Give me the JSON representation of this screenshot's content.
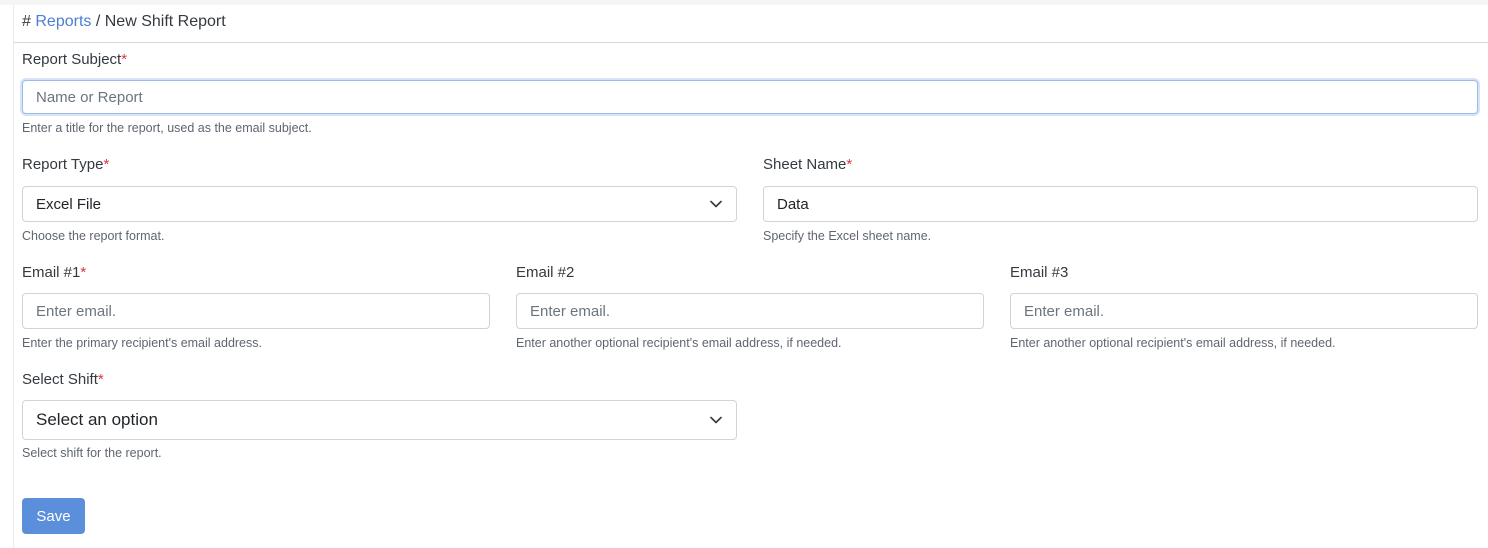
{
  "breadcrumb": {
    "hash": "#",
    "parent": "Reports",
    "separator": "/",
    "current": "New Shift Report"
  },
  "form": {
    "subject": {
      "label": "Report Subject",
      "required_mark": "*",
      "placeholder": "Name or Report",
      "value": "",
      "help": "Enter a title for the report, used as the email subject."
    },
    "report_type": {
      "label": "Report Type",
      "required_mark": "*",
      "selected": "Excel File",
      "help": "Choose the report format."
    },
    "sheet_name": {
      "label": "Sheet Name",
      "required_mark": "*",
      "value": "Data",
      "help": "Specify the Excel sheet name."
    },
    "email1": {
      "label": "Email #1",
      "required_mark": "*",
      "placeholder": "Enter email.",
      "value": "",
      "help": "Enter the primary recipient's email address."
    },
    "email2": {
      "label": "Email #2",
      "placeholder": "Enter email.",
      "value": "",
      "help": "Enter another optional recipient's email address, if needed."
    },
    "email3": {
      "label": "Email #3",
      "placeholder": "Enter email.",
      "value": "",
      "help": "Enter another optional recipient's email address, if needed."
    },
    "shift": {
      "label": "Select Shift",
      "required_mark": "*",
      "selected": "Select an option",
      "help": "Select shift for the report."
    },
    "save_label": "Save"
  },
  "icons": {
    "dropdown": "chevron-down-icon"
  },
  "colors": {
    "accent": "#5b8fdb",
    "link": "#4a7fd4",
    "required": "#dc3545"
  }
}
